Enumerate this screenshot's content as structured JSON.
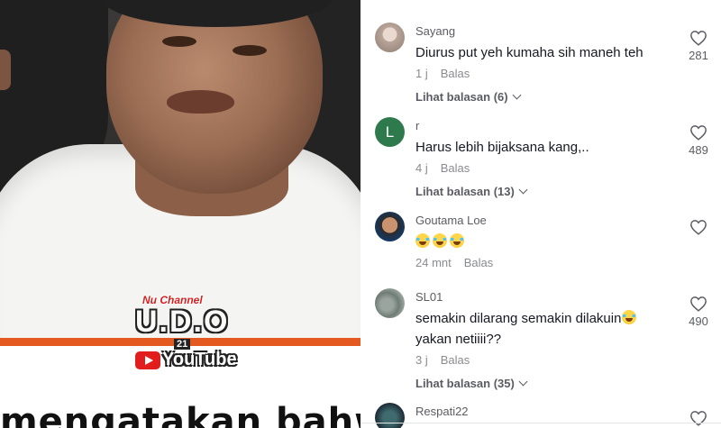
{
  "video": {
    "caption": "mengatakan bahwa mas",
    "logo": {
      "top": "Nu Channel",
      "main": "U.D.O",
      "num": "21",
      "yt": "YouTube"
    }
  },
  "comments": [
    {
      "username": "Sayang",
      "text": "Diurus put yeh kumaha sih maneh teh",
      "time": "1 j",
      "reply": "Balas",
      "replies": "Lihat balasan (6)",
      "likes": "281",
      "avatar": "photo"
    },
    {
      "username": "r",
      "text": "Harus lebih bijaksana kang,..",
      "time": "4 j",
      "reply": "Balas",
      "replies": "Lihat balasan (13)",
      "likes": "489",
      "avatar": "L"
    },
    {
      "username": "Goutama Loe",
      "text": "",
      "emojis": 3,
      "time": "24 mnt",
      "reply": "Balas",
      "replies": "",
      "likes": "",
      "avatar": "photo"
    },
    {
      "username": "SL01",
      "text": "semakin dilarang semakin dilakuin",
      "text2": "yakan netiiii??",
      "time": "3 j",
      "reply": "Balas",
      "replies": "Lihat balasan (35)",
      "likes": "490",
      "avatar": "photo"
    },
    {
      "username": "Respati22",
      "avatar": "photo"
    }
  ],
  "icons": {
    "like": "heart-outline-icon",
    "expand": "chevron-down-icon",
    "emoji": "laughing-tears-emoji"
  },
  "colors": {
    "accent_bar": "#e3591f",
    "avatar_letter_bg": "#2f7a4c",
    "muted_text": "#8a8b91"
  }
}
